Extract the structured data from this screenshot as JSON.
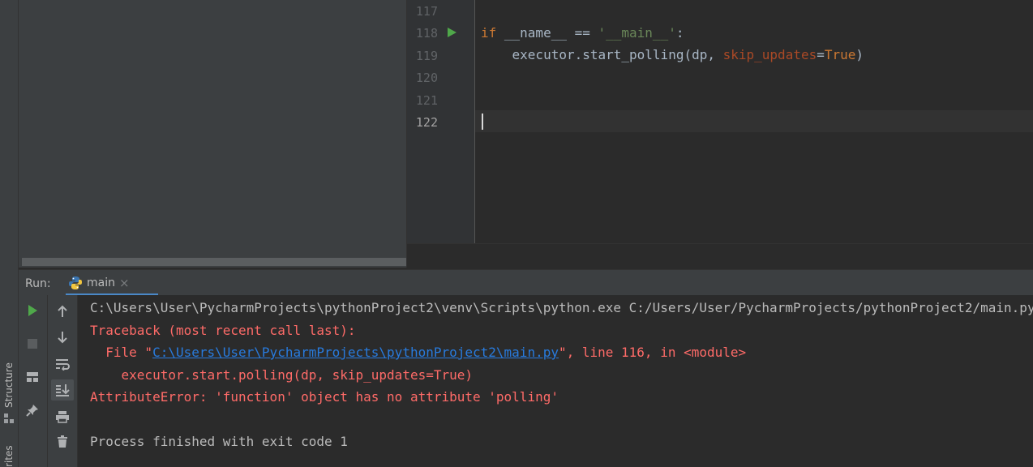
{
  "left_strip": {
    "structure_tab": "Structure",
    "favorites_tab": "rites"
  },
  "editor": {
    "line_numbers": [
      "117",
      "118",
      "119",
      "120",
      "121",
      "122"
    ],
    "code": {
      "line118": {
        "kw": "if",
        "a": " __name__ == ",
        "str": "'__main__'",
        "b": ":"
      },
      "line119": {
        "a": "    executor.start_polling(dp, ",
        "param": "skip_updates",
        "eq": "=",
        "kw": "True",
        "b": ")"
      }
    }
  },
  "run": {
    "label": "Run:",
    "tab_label": "main",
    "close": "×"
  },
  "console": {
    "cmd_line": "C:\\Users\\User\\PycharmProjects\\pythonProject2\\venv\\Scripts\\python.exe C:/Users/User/PycharmProjects/pythonProject2/main.py",
    "traceback": "Traceback (most recent call last):",
    "file_prefix": "  File \"",
    "file_link": "C:\\Users\\User\\PycharmProjects\\pythonProject2\\main.py",
    "file_suffix": "\", line 116, in <module>",
    "code_line": "    executor.start.polling(dp, skip_updates=True)",
    "error": "AttributeError: 'function' object has no attribute 'polling'",
    "finished": "Process finished with exit code 1"
  },
  "colors": {
    "keyword": "#cc7832",
    "string": "#6a8759",
    "parameter": "#aa4926",
    "error_text": "#ff6b68",
    "link": "#287bde",
    "run_green": "#4fa84a"
  }
}
